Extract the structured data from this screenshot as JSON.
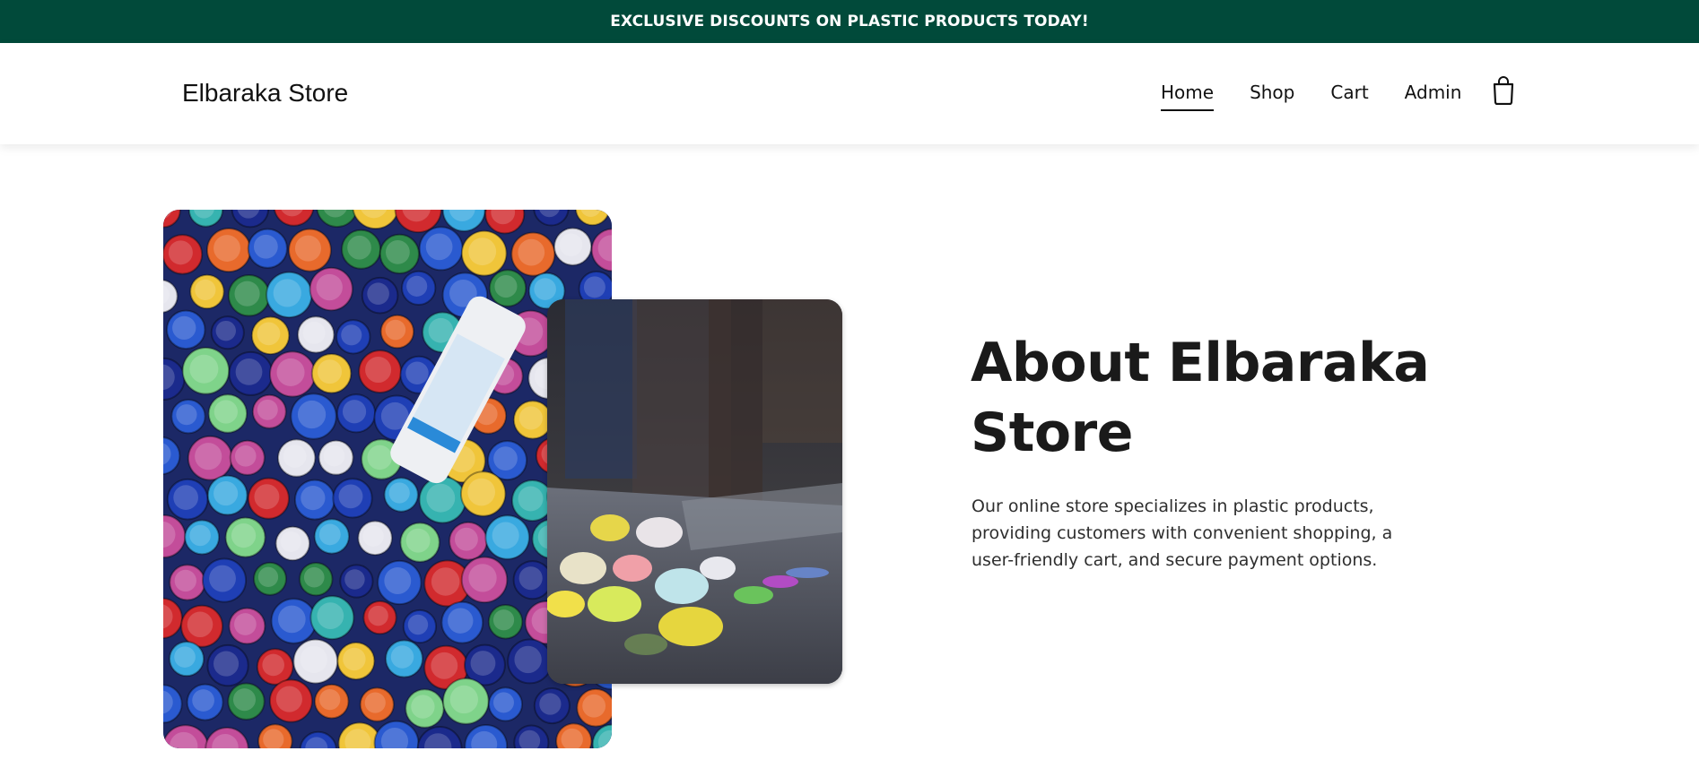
{
  "announcement": {
    "text": "EXCLUSIVE DISCOUNTS ON PLASTIC PRODUCTS TODAY!"
  },
  "header": {
    "logo": "Elbaraka Store",
    "nav": [
      {
        "label": "Home",
        "active": true
      },
      {
        "label": "Shop",
        "active": false
      },
      {
        "label": "Cart",
        "active": false
      },
      {
        "label": "Admin",
        "active": false
      }
    ],
    "cart_icon": "shopping-bag-icon"
  },
  "about": {
    "title": "About Elbaraka Store",
    "description": "Our online store specializes in plastic products, providing customers with convenient shopping, a user-friendly cart, and secure payment options."
  },
  "images": {
    "primary": "plastic-bottle-caps-photo",
    "secondary": "plastic-toys-in-water-tray-photo"
  },
  "colors": {
    "announcement_bg": "#014a3a",
    "announcement_text": "#ffffff",
    "text": "#1a1a1a"
  }
}
